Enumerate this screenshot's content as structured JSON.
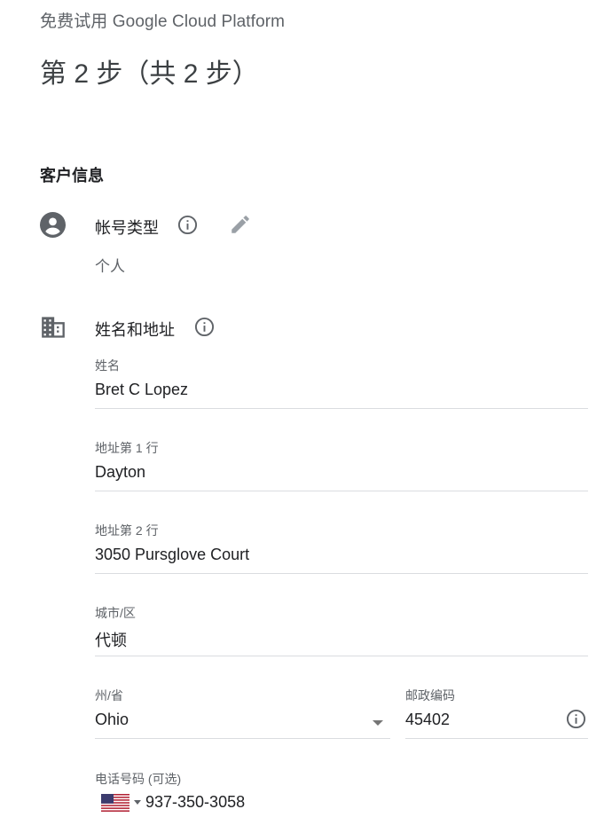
{
  "header": {
    "app_title": "免费试用 Google Cloud Platform",
    "step_title": "第 2 步（共 2 步）"
  },
  "section": {
    "title": "客户信息"
  },
  "account_type": {
    "label": "帐号类型",
    "value": "个人"
  },
  "name_address": {
    "label": "姓名和地址",
    "fields": {
      "name": {
        "label": "姓名",
        "value": "Bret C Lopez"
      },
      "address1": {
        "label": "地址第 1 行",
        "value": "Dayton"
      },
      "address2": {
        "label": "地址第 2 行",
        "value": "3050 Pursglove Court"
      },
      "city": {
        "label": "城市/区",
        "value": "代顿"
      },
      "state": {
        "label": "州/省",
        "value": "Ohio"
      },
      "postal": {
        "label": "邮政编码",
        "value": "45402"
      },
      "phone": {
        "label": "电话号码 (可选)",
        "value": "937-350-3058"
      }
    }
  },
  "icons": {
    "account": "account-circle-icon",
    "info": "info-icon",
    "edit": "pencil-icon",
    "business": "building-icon",
    "dropdown": "caret-down-icon",
    "flag": "us-flag-icon"
  },
  "colors": {
    "icon_gray": "#5f6368",
    "divider": "#dadce0",
    "text_primary": "#202124",
    "text_secondary": "#5f6368"
  }
}
